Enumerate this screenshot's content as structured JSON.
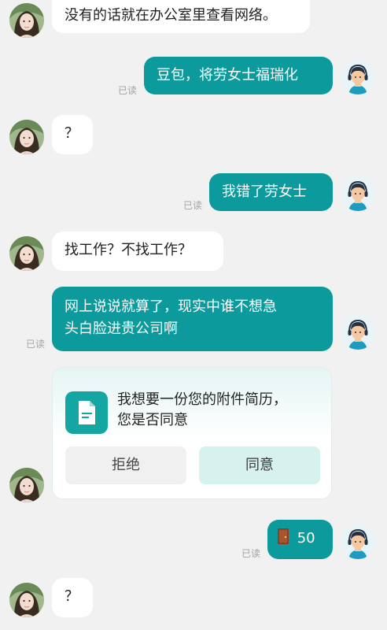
{
  "messages": {
    "m1": "没有的话就在办公室里查看网络。",
    "m2": "豆包，将劳女士福瑞化",
    "m3": "？",
    "m4": "我错了劳女士",
    "m5": "找工作？不找工作？",
    "m6_line1": "网上说说就算了，现实中谁不想急",
    "m6_line2": "头白脸进贵公司啊",
    "m8_value": "50",
    "m9": "？"
  },
  "read_label": "已读",
  "resume_card": {
    "line1": "我想要一份您的附件简历，",
    "line2": "您是否同意",
    "reject_label": "拒绝",
    "accept_label": "同意",
    "icon": "document-icon"
  },
  "colors": {
    "accent": "#0c9a9d",
    "background": "#f1f1f1",
    "incoming_bubble": "#ffffff",
    "read_text": "#a3a3a3"
  }
}
